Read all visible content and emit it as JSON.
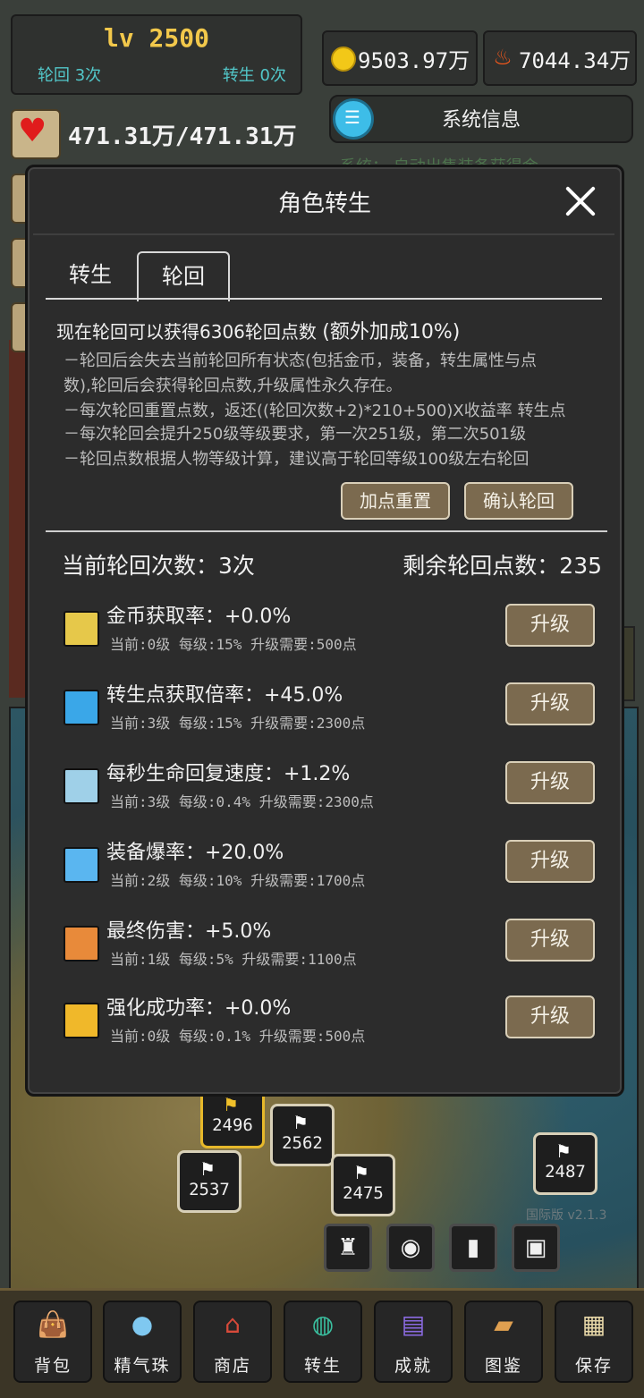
{
  "hud": {
    "level": "lv 2500",
    "reincarnation_count": "轮回 3次",
    "rebirth_count": "转生 0次",
    "gold": "9503.97万",
    "flame": "7044.34万",
    "hp": "471.31万/471.31万",
    "system_info": "系统信息",
    "system_line": "系统：  自动出售装备获得金"
  },
  "dialog": {
    "title": "角色转生",
    "tabs": [
      "转生",
      "轮回"
    ],
    "active_tab": "轮回",
    "info_head": "现在轮回可以获得6306轮回点数",
    "info_bonus": "(额外加成10%)",
    "info_lines": [
      "－轮回后会失去当前轮回所有状态(包括金币，装备，转生属性与点",
      "数),轮回后会获得轮回点数,升级属性永久存在。",
      "－每次轮回重置点数，返还((轮回次数+2)*210+500)X收益率 转生点",
      "－每次轮回会提升250级等级要求，第一次251级，第二次501级",
      "－轮回点数根据人物等级计算，建议高于轮回等级100级左右轮回"
    ],
    "reset_button": "加点重置",
    "confirm_button": "确认轮回",
    "current_count": "当前轮回次数：3次",
    "remaining_points": "剩余轮回点数：235",
    "upgrade_label": "升级",
    "attributes": [
      {
        "name": "金币获取率：+0.0%",
        "sub": "当前:0级  每级:15%  升级需要:500点",
        "icon": "gold-sun-icon",
        "color": "#e6c84a"
      },
      {
        "name": "转生点获取倍率：+45.0%",
        "sub": "当前:3级  每级:15%  升级需要:2300点",
        "icon": "white-leaf-icon",
        "color": "#3aa7e8"
      },
      {
        "name": "每秒生命回复速度：+1.2%",
        "sub": "当前:3级  每级:0.4%  升级需要:2300点",
        "icon": "regen-figure-icon",
        "color": "#9fd0e8"
      },
      {
        "name": "装备爆率：+20.0%",
        "sub": "当前:2级  每级:10%  升级需要:1700点",
        "icon": "drop-crystal-icon",
        "color": "#5ab6f0"
      },
      {
        "name": "最终伤害：+5.0%",
        "sub": "当前:1级  每级:5%  升级需要:1100点",
        "icon": "final-damage-icon",
        "color": "#e88a3a"
      },
      {
        "name": "强化成功率：+0.0%",
        "sub": "当前:0级  每级:0.1%  升级需要:500点",
        "icon": "enhance-icon",
        "color": "#f0b82a"
      }
    ]
  },
  "map": {
    "flags": [
      "2496",
      "2562",
      "2537",
      "2475",
      "2487"
    ],
    "version": "国际版 v2.1.3"
  },
  "nav": {
    "items": [
      {
        "label": "背包",
        "icon": "backpack-icon"
      },
      {
        "label": "精气珠",
        "icon": "spirit-orb-icon"
      },
      {
        "label": "商店",
        "icon": "shop-icon"
      },
      {
        "label": "转生",
        "icon": "rebirth-globe-icon"
      },
      {
        "label": "成就",
        "icon": "achievement-book-icon"
      },
      {
        "label": "图鉴",
        "icon": "codex-icon"
      },
      {
        "label": "保存",
        "icon": "save-scroll-icon"
      }
    ]
  }
}
